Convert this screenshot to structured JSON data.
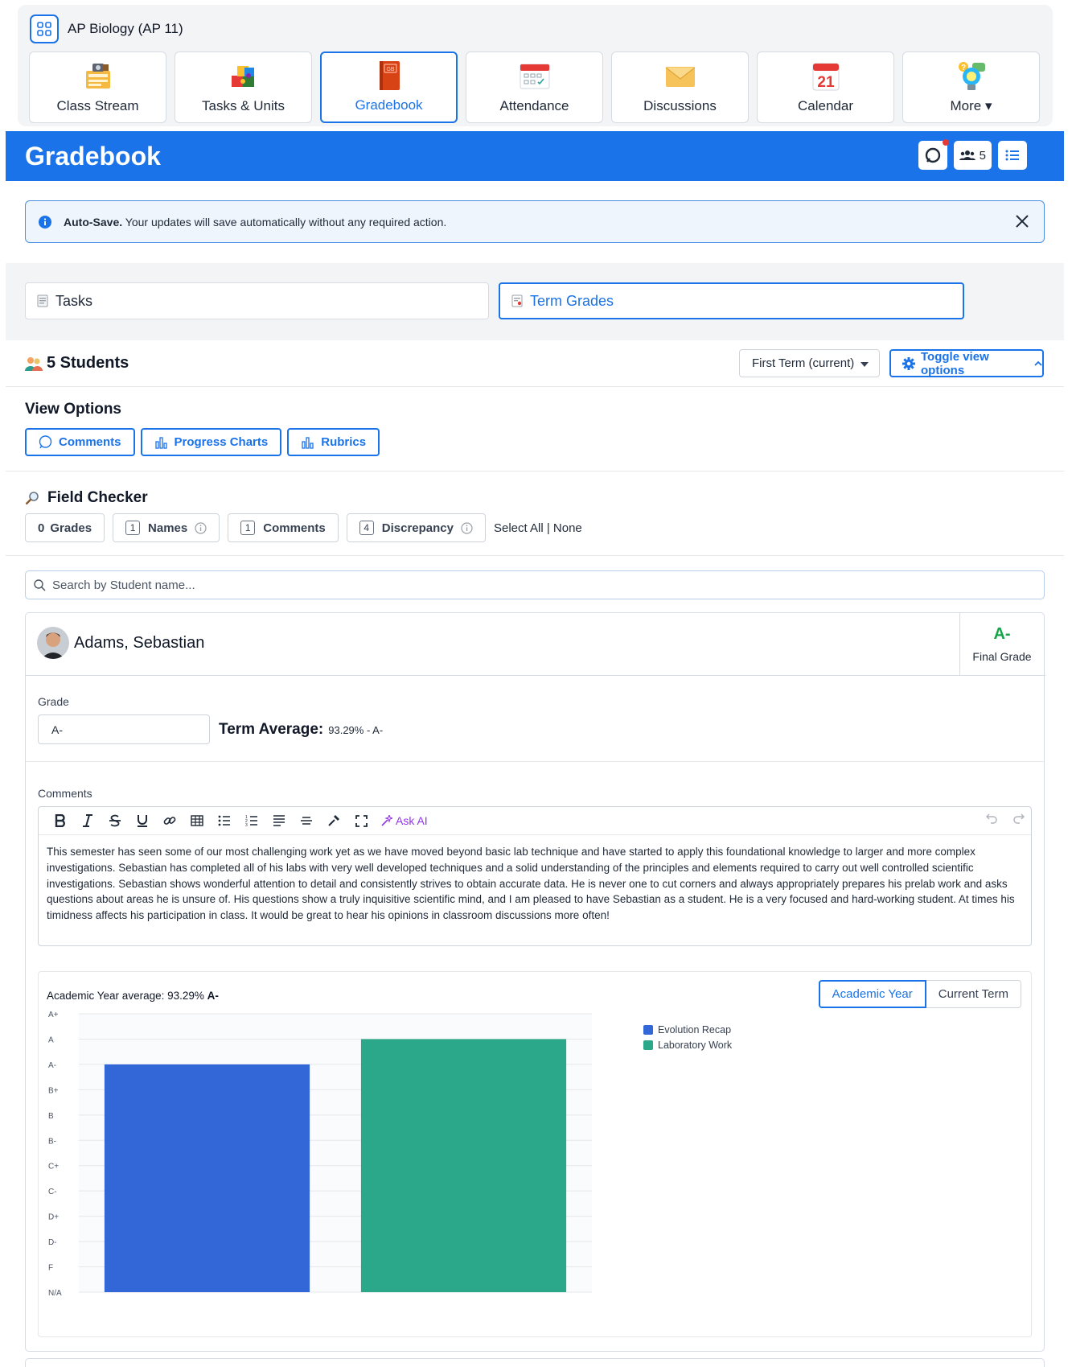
{
  "course": {
    "title": "AP Biology (AP 11)",
    "icon": "grid-icon"
  },
  "nav_tabs": [
    {
      "label": "Class Stream",
      "icon": "class-stream-icon"
    },
    {
      "label": "Tasks & Units",
      "icon": "puzzle-icon"
    },
    {
      "label": "Gradebook",
      "icon": "gradebook-icon",
      "active": true
    },
    {
      "label": "Attendance",
      "icon": "attendance-icon"
    },
    {
      "label": "Discussions",
      "icon": "envelope-icon"
    },
    {
      "label": "Calendar",
      "icon": "calendar-icon",
      "day": "21"
    },
    {
      "label": "More",
      "icon": "lightbulb-icon"
    }
  ],
  "header": {
    "title": "Gradebook",
    "people_count": "5"
  },
  "alert": {
    "bold": "Auto-Save.",
    "text": " Your updates will save automatically without any required action."
  },
  "segments": {
    "tasks": "Tasks",
    "term_grades": "Term Grades"
  },
  "students": {
    "title": "5 Students",
    "term": "First Term (current)",
    "toggle": "Toggle view options"
  },
  "view_options": {
    "title": "View Options",
    "comments": "Comments",
    "progress_charts": "Progress Charts",
    "rubrics": "Rubrics"
  },
  "field_checker": {
    "title": "Field Checker",
    "grades_count": "0",
    "grades": "Grades",
    "names_count": "1",
    "names": "Names",
    "comments_count": "1",
    "comments": "Comments",
    "discrepancy_count": "4",
    "discrepancy": "Discrepancy",
    "select": "Select All | None"
  },
  "search": {
    "placeholder": "Search by Student name..."
  },
  "student": {
    "name": "Adams, Sebastian",
    "final_grade": "A-",
    "final_grade_label": "Final Grade",
    "grade_label": "Grade",
    "grade_value": "A-",
    "term_avg_label": "Term Average:",
    "term_avg_value": "93.29% - A-",
    "comments_label": "Comments",
    "ask_ai": "Ask AI",
    "comment_text": "This semester has seen some of our most challenging work yet as we have moved beyond basic lab technique and have started to apply this foundational knowledge to larger and more complex investigations. Sebastian has completed all of his labs with very well developed techniques and a solid understanding of the principles and elements required to carry out well controlled scientific investigations. Sebastian shows wonderful attention to detail and consistently strives to obtain accurate data. He is never one to cut corners and always appropriately prepares his prelab work and asks questions about areas he is unsure of. His questions show a truly inquisitive scientific mind, and I am pleased to have Sebastian as a student. He is a very focused and hard-working student. At times his timidness affects his participation in class. It would be great to hear his opinions in classroom discussions more often!"
  },
  "chart_toggle": {
    "academic_year": "Academic Year",
    "current_term": "Current Term"
  },
  "chart_data": {
    "type": "bar",
    "title_prefix": "Academic Year average: 93.29% ",
    "title_grade": "A-",
    "y_ticks": [
      "A+",
      "A",
      "A-",
      "B+",
      "B",
      "B-",
      "C+",
      "C-",
      "D+",
      "D-",
      "F",
      "N/A"
    ],
    "series": [
      {
        "name": "Evolution Recap",
        "value": "A-",
        "color": "#3366d6"
      },
      {
        "name": "Laboratory Work",
        "value": "A",
        "color": "#2aa889"
      }
    ],
    "grid": true,
    "legend": "right"
  }
}
